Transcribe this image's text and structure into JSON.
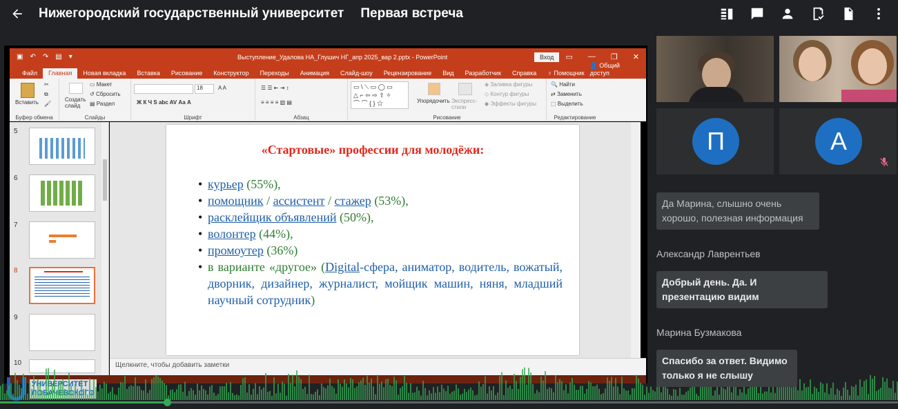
{
  "header": {
    "org_title": "Нижегородский государственный университет",
    "meeting_title": "Первая встреча",
    "icons": [
      "back-arrow-icon",
      "transcript-icon",
      "chat-icon",
      "people-icon",
      "activities-icon",
      "document-icon",
      "more-vert-icon"
    ]
  },
  "ppt": {
    "file_title": "Выступление_Удалова НА_Глушич НГ_апр 2025_вар 2.pptx  -  PowerPoint",
    "login": "Вход",
    "tabs": [
      "Файл",
      "Главная",
      "Новая вкладка",
      "Вставка",
      "Рисование",
      "Конструктор",
      "Переходы",
      "Анимация",
      "Слайд-шоу",
      "Рецензирование",
      "Вид",
      "Разработчик",
      "Справка",
      "Помощник"
    ],
    "share": "Общий доступ",
    "ribbon": {
      "paste": "Вставить",
      "create_slide": "Создать слайд",
      "layout": "Макет",
      "reset": "Сбросить",
      "section": "Раздел",
      "font_size": "18",
      "arrange": "Упорядочить",
      "express_styles": "Экспресс-стили",
      "fill": "Заливка фигуры",
      "outline": "Контур фигуры",
      "effects": "Эффекты фигуры",
      "find": "Найти",
      "replace": "Заменить",
      "select": "Выделить",
      "groups": [
        "Буфер обмена",
        "Слайды",
        "Шрифт",
        "Абзац",
        "Рисование",
        "Редактирование"
      ]
    },
    "thumb_numbers": [
      "5",
      "6",
      "7",
      "8",
      "9",
      "10"
    ],
    "slide": {
      "title": "«Стартовые» профессии для молодёжи:",
      "item1_link": "курьер",
      "item1_rest": " (55%),",
      "item2_link_a": "помощник",
      "item2_sep1": " / ",
      "item2_link_b": "ассистент",
      "item2_sep2": " / ",
      "item2_link_c": "стажер",
      "item2_rest": " (53%),",
      "item3_link": "расклейщик объявлений",
      "item3_rest": " (50%),",
      "item4_link": "волонтер",
      "item4_rest": " (44%),",
      "item5_link": "промоутер",
      "item5_rest": " (36%)",
      "item6_a": "в варианте «другое» (",
      "item6_digital": "Digital",
      "item6_b": "-сфера, аниматор, водитель, вожатый, дворник, дизайнер, журналист, мойщик машин, няня, младший научный сотрудник",
      "item6_c": ")"
    },
    "notes_placeholder": "Щелкните, чтобы добавить заметки"
  },
  "logo": {
    "line1": "УНИВЕРСИТЕТ",
    "line2": "ЛОБАЧЕВСКОГО"
  },
  "playback": {
    "progress": 0.186
  },
  "participants": [
    {
      "kind": "video"
    },
    {
      "kind": "video"
    },
    {
      "kind": "avatar",
      "initial": "П"
    },
    {
      "kind": "avatar",
      "initial": "А",
      "muted": true
    }
  ],
  "chat": [
    {
      "sender": "",
      "text": "Да Марина, слышно очень хорошо, полезная информация"
    },
    {
      "sender": "Александр Лаврентьев",
      "text": "Добрый день. Да. И презентацию видим"
    },
    {
      "sender": "Марина Бузмакова",
      "text": "Спасибо за ответ. Видимо только я не слышу"
    }
  ],
  "colors": {
    "accent_green": "#34a853",
    "ppt_red": "#c43e1c",
    "avatar_blue": "#1e6fc2",
    "slide_title_red": "#e0281b"
  }
}
